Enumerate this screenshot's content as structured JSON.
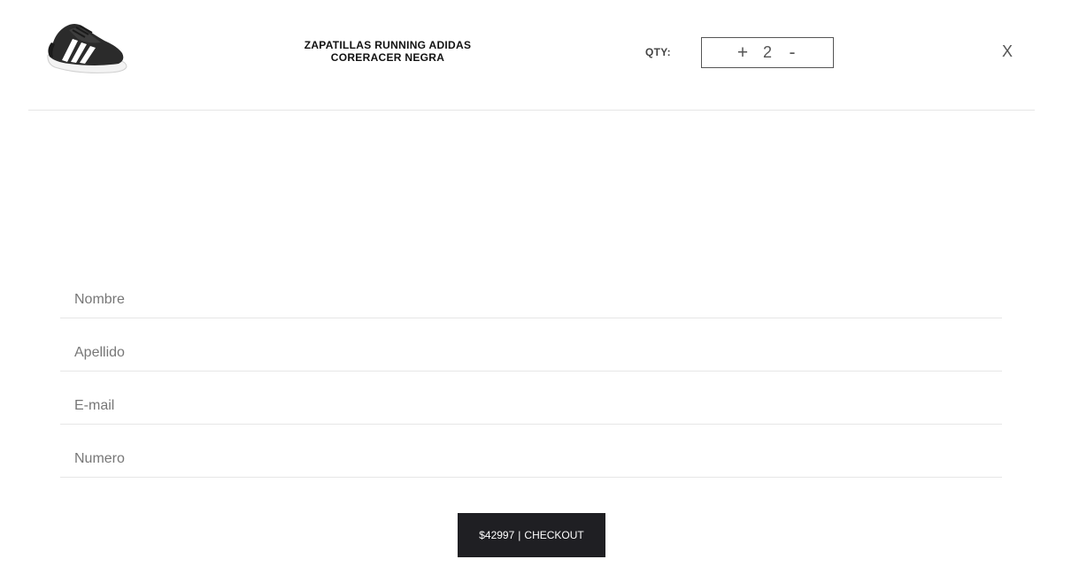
{
  "cart_item": {
    "image_icon": "sneaker-image",
    "title_line1": "ZAPATILLAS RUNNING ADIDAS",
    "title_line2": "CORERACER NEGRA",
    "qty_label": "QTY:",
    "qty_increment": "+",
    "qty_value": "2",
    "qty_decrement": "-",
    "close_label": "X"
  },
  "form": {
    "first_name_placeholder": "Nombre",
    "last_name_placeholder": "Apellido",
    "email_placeholder": "E-mail",
    "phone_placeholder": "Numero"
  },
  "checkout": {
    "total": "$42997",
    "separator": "|",
    "label": "CHECKOUT"
  },
  "colors": {
    "button_bg": "#1f1f23",
    "divider": "#e6e6e6"
  }
}
